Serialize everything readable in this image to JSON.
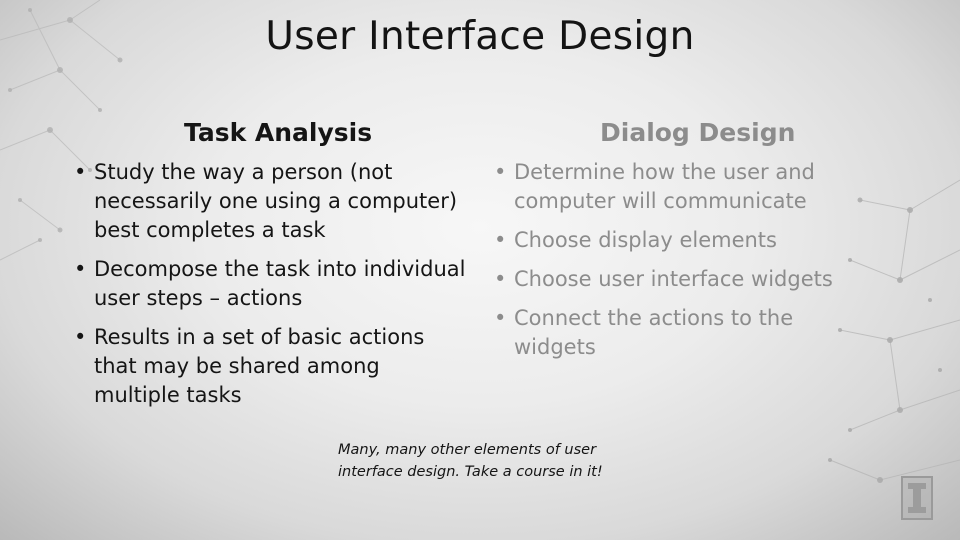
{
  "slide": {
    "title": "User Interface Design",
    "left_column": {
      "heading": "Task Analysis",
      "bullets": [
        "Study the way a person (not necessarily one using a computer) best completes a task",
        "Decompose the task into individual user steps – actions",
        "Results in a set of basic actions that may be shared among multiple tasks"
      ]
    },
    "right_column": {
      "heading": "Dialog Design",
      "bullets": [
        "Determine how the user and computer will communicate",
        "Choose display elements",
        "Choose user interface widgets",
        "Connect the actions to the widgets"
      ]
    },
    "note": {
      "line1": "Many, many other elements of user",
      "line2": "interface design. Take a course in it!"
    },
    "bullet_char": "•",
    "logo_icon": "block-i-logo",
    "colors": {
      "active_text": "#151515",
      "muted_text": "#8c8c8c"
    }
  }
}
